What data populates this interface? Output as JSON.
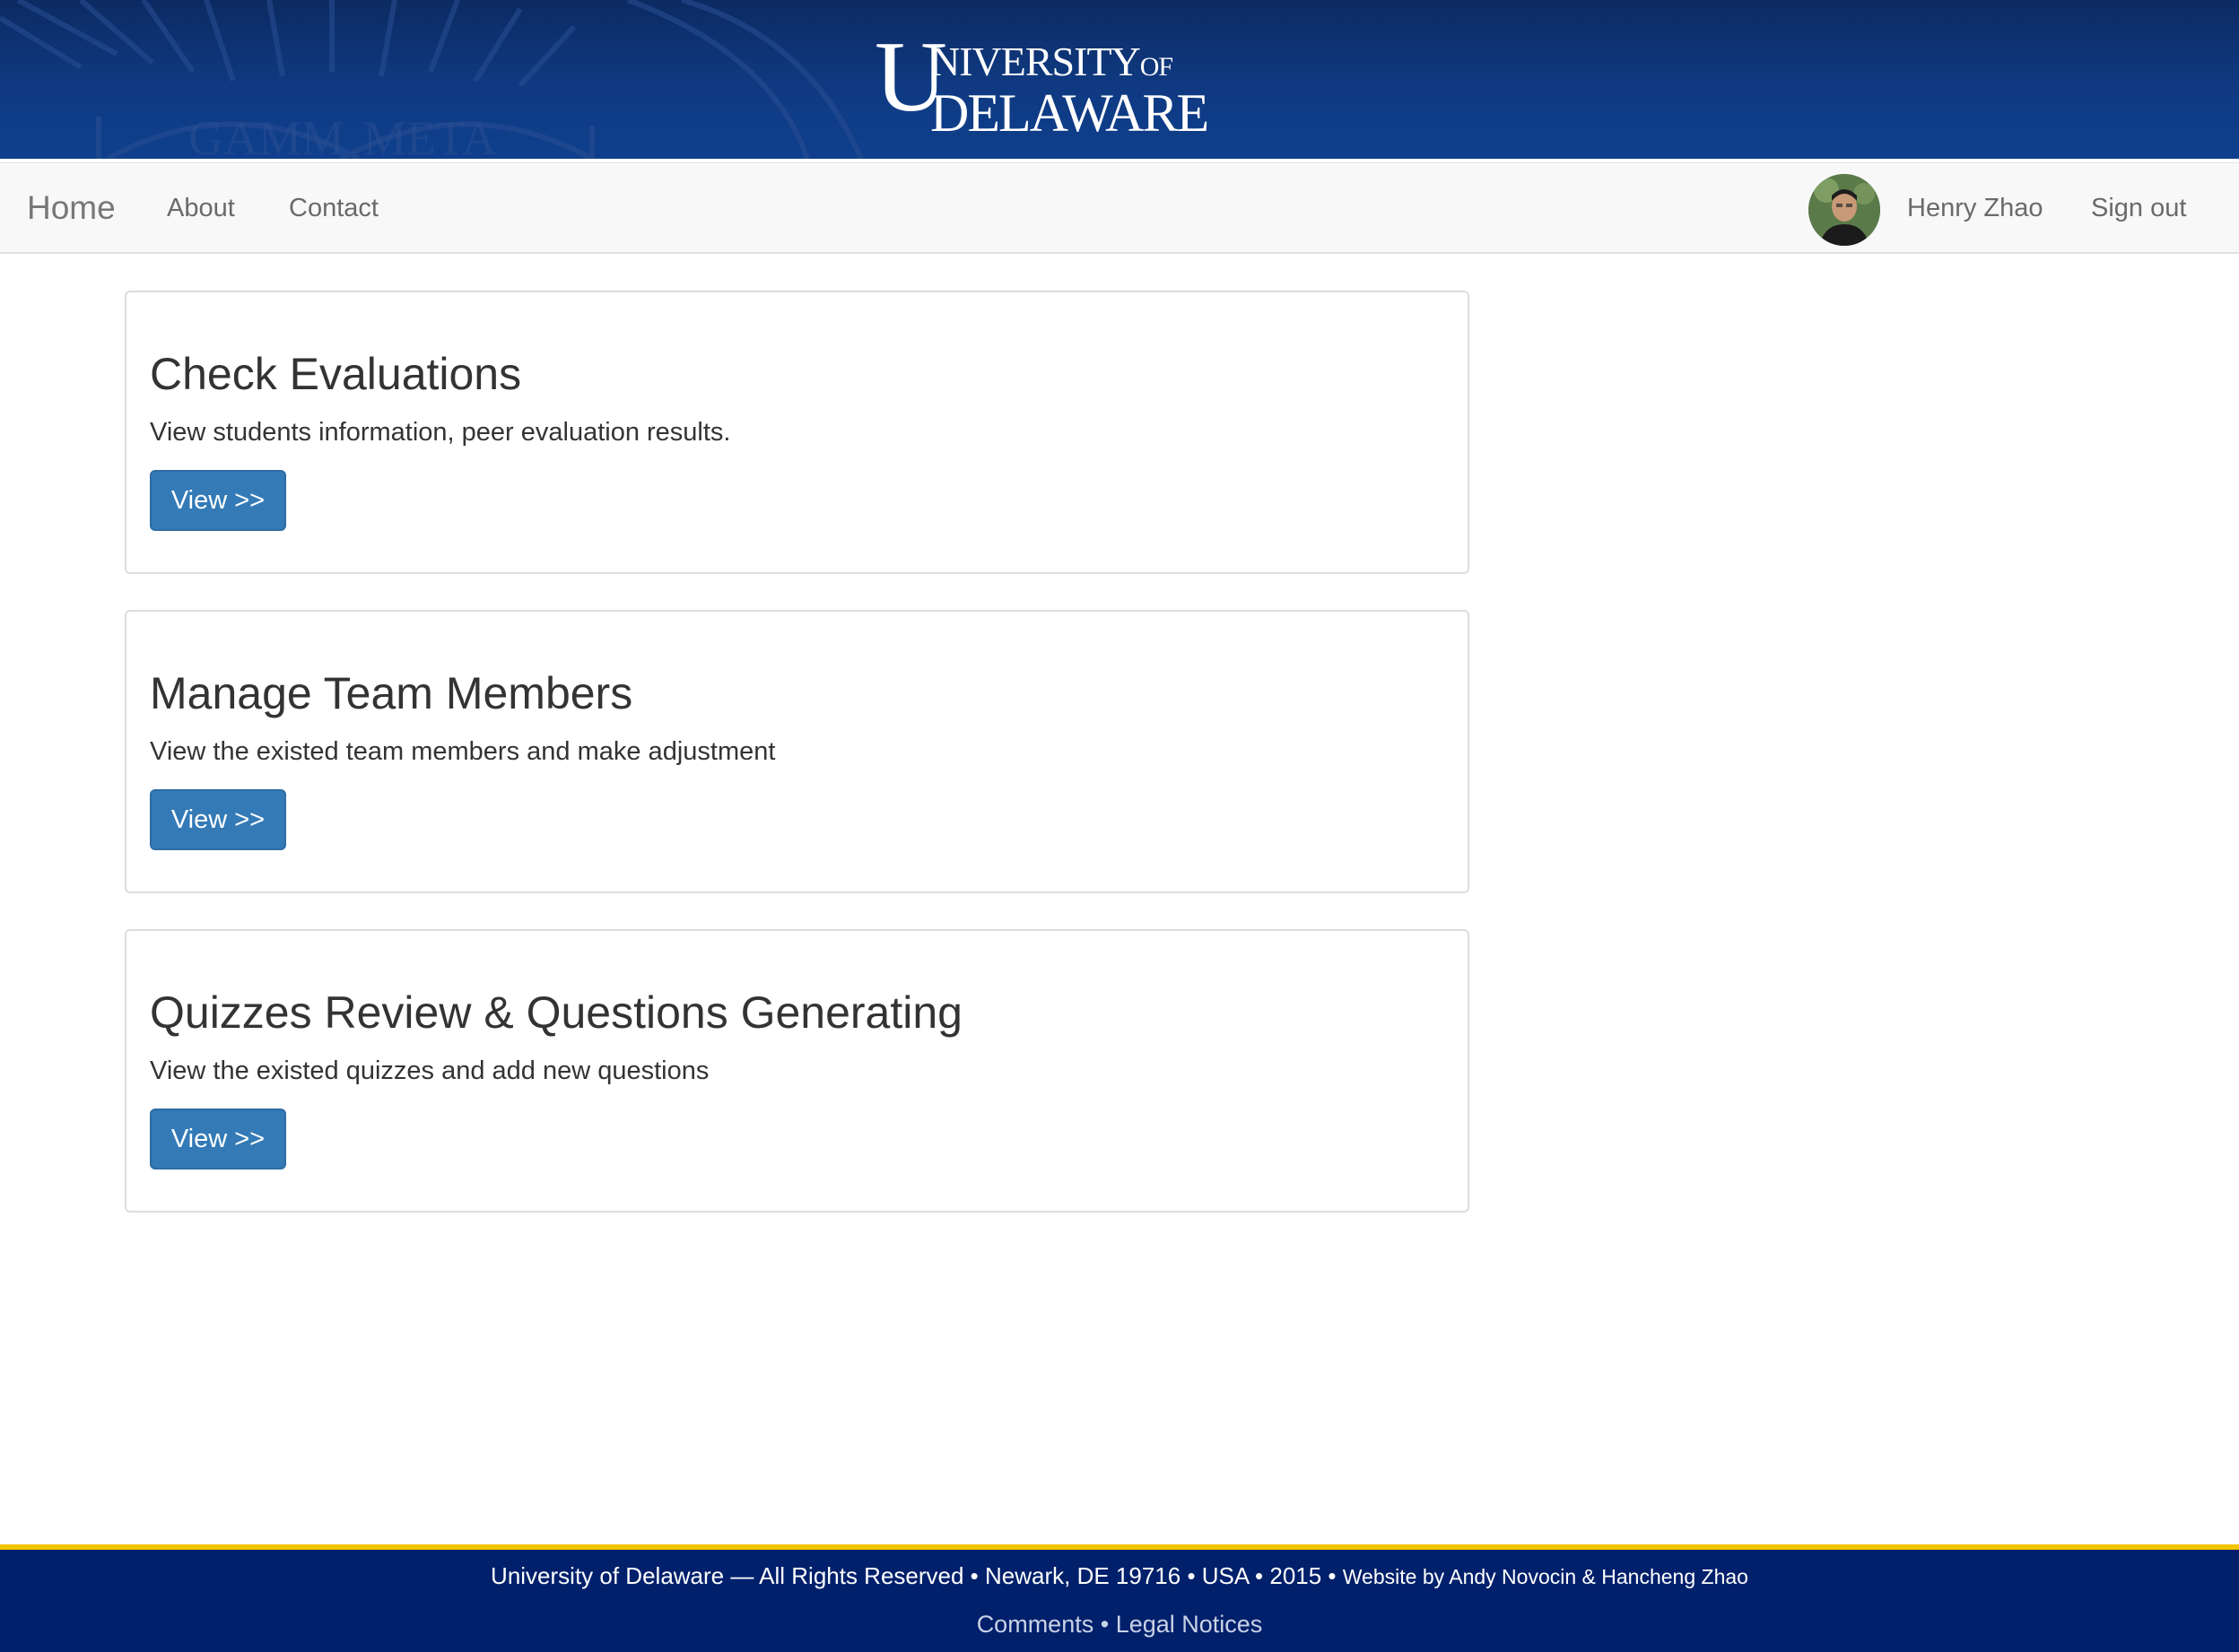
{
  "banner": {
    "logo_letter_u": "U",
    "logo_top": "NIVERSITY",
    "logo_of": "OF",
    "logo_bottom": "DELAWARE",
    "seal_text_left": "GAMM",
    "seal_text_right": "META"
  },
  "navbar": {
    "brand": "Home",
    "links": [
      "About",
      "Contact"
    ],
    "user_name": "Henry Zhao",
    "sign_out": "Sign out"
  },
  "cards": [
    {
      "title": "Check Evaluations",
      "description": "View students information, peer evaluation results.",
      "button": "View >>"
    },
    {
      "title": "Manage Team Members",
      "description": "View the existed team members and make adjustment",
      "button": "View >>"
    },
    {
      "title": "Quizzes Review & Questions Generating",
      "description": "View the existed quizzes and add new questions",
      "button": "View >>"
    }
  ],
  "footer": {
    "copyright": "University of Delaware — All Rights Reserved • Newark, DE 19716 • USA • 2015 •",
    "credit": "Website by Andy Novocin & Hancheng Zhao",
    "comments": "Comments",
    "separator": "•",
    "legal": "Legal Notices"
  },
  "colors": {
    "banner": "#0f3a82",
    "primary_button": "#337ab7",
    "footer": "#00206b",
    "footer_accent": "#f2c500"
  }
}
